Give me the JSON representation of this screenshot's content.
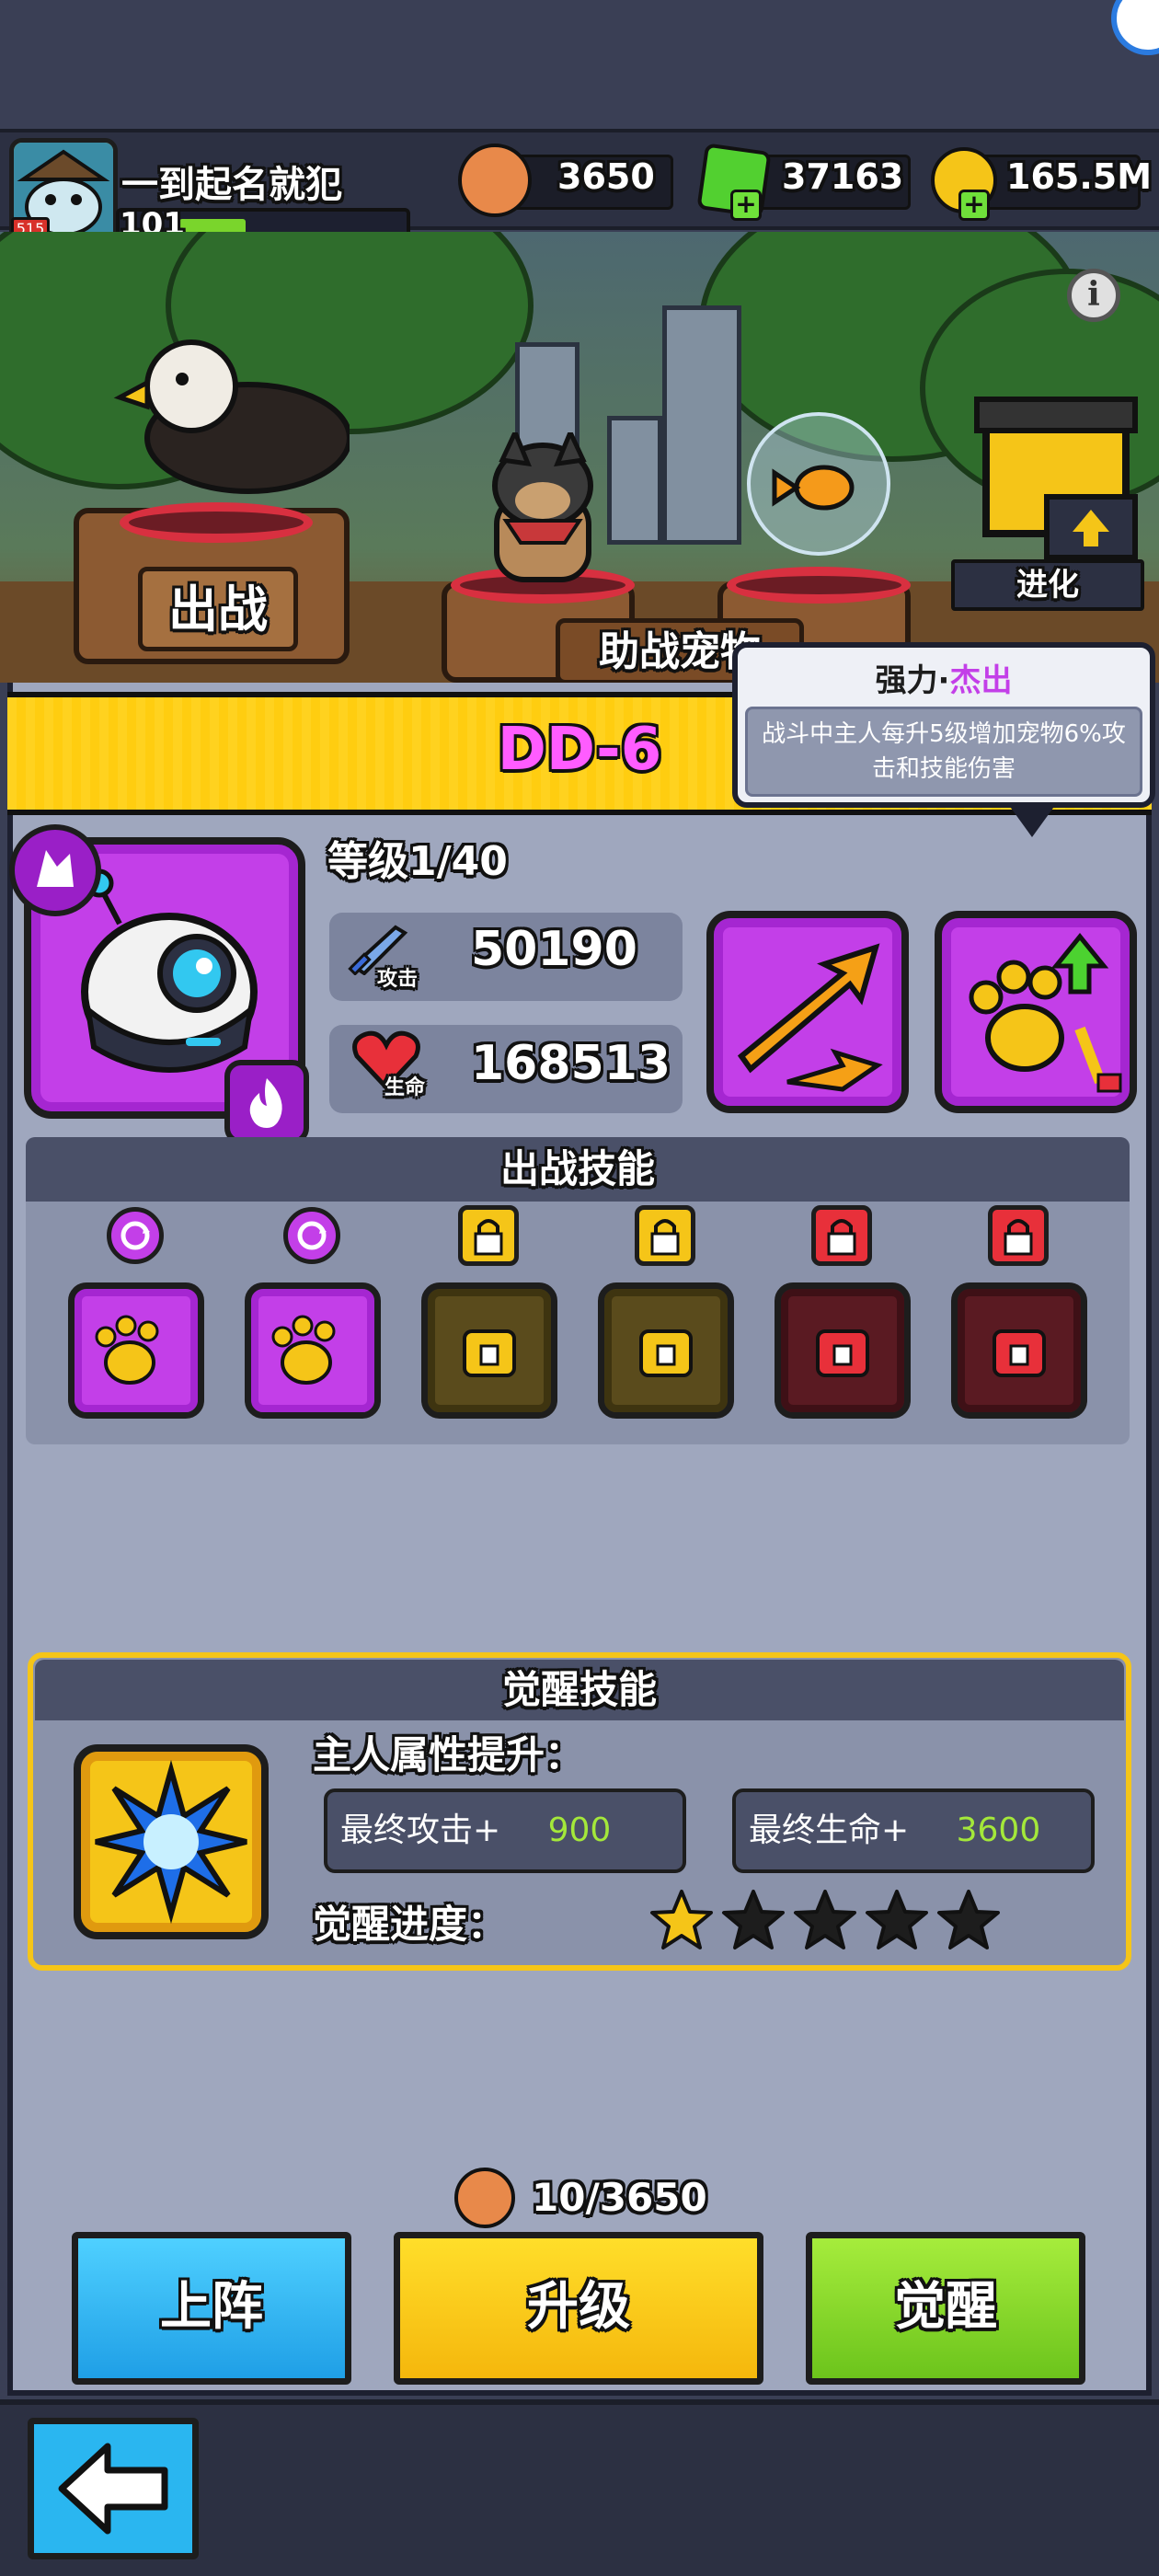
{
  "player": {
    "name": "一到起名就犯",
    "level": "101",
    "avatar_badge": "515",
    "xp_fraction": 0.3
  },
  "currencies": [
    {
      "icon": "paw-coin-icon",
      "value": "3650"
    },
    {
      "icon": "green-gem-icon",
      "value": "37163"
    },
    {
      "icon": "gold-coin-icon",
      "value": "165.5M"
    }
  ],
  "scene": {
    "deploy_sign": "出战",
    "assist_sign": "助战宠物",
    "evolve_label": "进化"
  },
  "pet": {
    "name": "DD-6",
    "level_label": "等级1/40"
  },
  "tooltip": {
    "title_prefix": "强力·",
    "title_highlight": "杰出",
    "body": "战斗中主人每升5级增加宠物6%攻击和技能伤害"
  },
  "stats": {
    "attack_label": "攻击",
    "attack_value": "50190",
    "hp_label": "生命",
    "hp_value": "168513"
  },
  "battle_skills": {
    "title": "出战技能",
    "slots": [
      {
        "name": "paw-cooldown-skill",
        "state": "unlocked"
      },
      {
        "name": "heal-scroll-skill",
        "state": "unlocked"
      },
      {
        "name": "paw-shield-skill",
        "state": "locked-gold"
      },
      {
        "name": "paw-heal-skill",
        "state": "locked-gold"
      },
      {
        "name": "chest-percent-skill",
        "state": "locked-red"
      },
      {
        "name": "orbit-skill",
        "state": "locked-red"
      }
    ]
  },
  "awaken": {
    "title": "觉醒技能",
    "attr_label": "主人属性提升：",
    "attack_label": "最终攻击+",
    "attack_value": "900",
    "hp_label": "最终生命+",
    "hp_value": "3600",
    "progress_label": "觉醒进度：",
    "stars_filled": 1,
    "stars_total": 5
  },
  "upgrade_cost": "10/3650",
  "buttons": {
    "deploy": "上阵",
    "upgrade": "升级",
    "awaken": "觉醒"
  },
  "colors": {
    "purple": "#c33fe8",
    "yellow": "#ffd21f",
    "blue": "#2ab6f0",
    "green": "#8ad62a"
  }
}
